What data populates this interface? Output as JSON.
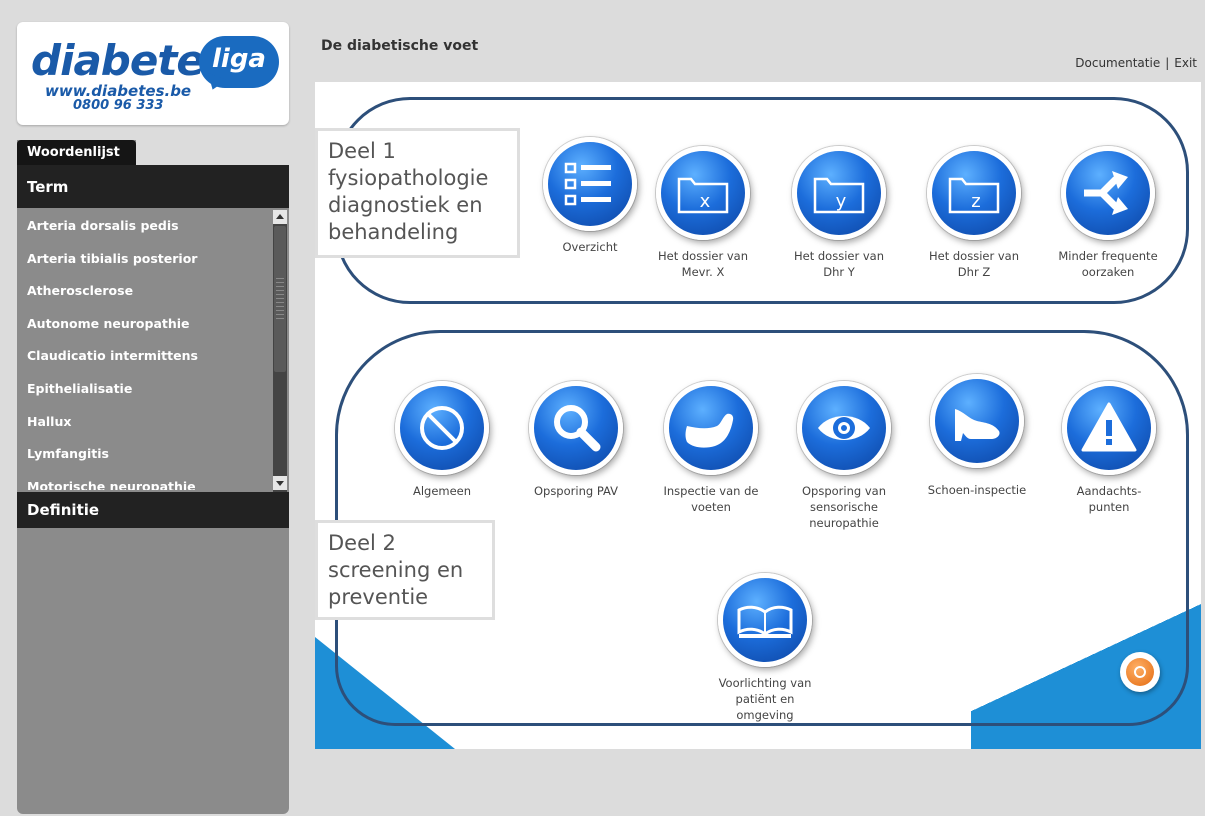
{
  "logo": {
    "word": "diabetes",
    "bubble": "liga",
    "url": "www.diabetes.be",
    "phone": "0800 96 333"
  },
  "sidebar": {
    "tab": "Woordenlijst",
    "term_header": "Term",
    "terms": [
      "Arteria dorsalis pedis",
      "Arteria tibialis posterior",
      "Atherosclerose",
      "Autonome neuropathie",
      "Claudicatio intermittens",
      "Epithelialisatie",
      "Hallux",
      "Lymfangitis",
      "Motorische neuropathie"
    ],
    "definitie_header": "Definitie"
  },
  "header": {
    "title": "De diabetische voet",
    "link_documentatie": "Documentatie",
    "separator": "|",
    "link_exit": "Exit"
  },
  "section1": {
    "label_line1": "Deel 1",
    "label_line2": "fysiopathologie",
    "label_line3": "diagnostiek en",
    "label_line4": "behandeling",
    "tiles": [
      {
        "icon": "list-icon",
        "line1": "Overzicht",
        "line2": ""
      },
      {
        "icon": "folder-x-icon",
        "glyph": "x",
        "line1": "Het dossier van",
        "line2": "Mevr. X"
      },
      {
        "icon": "folder-y-icon",
        "glyph": "y",
        "line1": "Het dossier van",
        "line2": "Dhr Y"
      },
      {
        "icon": "folder-z-icon",
        "glyph": "z",
        "line1": "Het dossier van",
        "line2": "Dhr Z"
      },
      {
        "icon": "branch-arrow-icon",
        "line1": "Minder frequente",
        "line2": "oorzaken"
      }
    ]
  },
  "section2": {
    "label_line1": "Deel 2",
    "label_line2": "screening en",
    "label_line3": "preventie",
    "tiles": [
      {
        "icon": "prohibited-icon",
        "line1": "Algemeen",
        "line2": "",
        "line3": ""
      },
      {
        "icon": "magnifier-icon",
        "line1": "Opsporing PAV",
        "line2": "",
        "line3": ""
      },
      {
        "icon": "foot-icon",
        "line1": "Inspectie van de",
        "line2": "voeten",
        "line3": ""
      },
      {
        "icon": "eye-icon",
        "line1": "Opsporing van",
        "line2": "sensorische",
        "line3": "neuropathie"
      },
      {
        "icon": "shoe-icon",
        "line1": "Schoen-inspectie",
        "line2": "",
        "line3": ""
      },
      {
        "icon": "warning-icon",
        "line1": "Aandachts-",
        "line2": "punten",
        "line3": ""
      },
      {
        "icon": "book-icon",
        "line1": "Voorlichting van",
        "line2": "patiënt en",
        "line3": "omgeving"
      }
    ]
  },
  "colors": {
    "icon_blue": "#1c6ddb",
    "panel_border": "#2d4f7a",
    "deco_blue": "#1e8fd6",
    "help_orange": "#e36a10",
    "sidebar_bg": "#8b8b8b"
  }
}
